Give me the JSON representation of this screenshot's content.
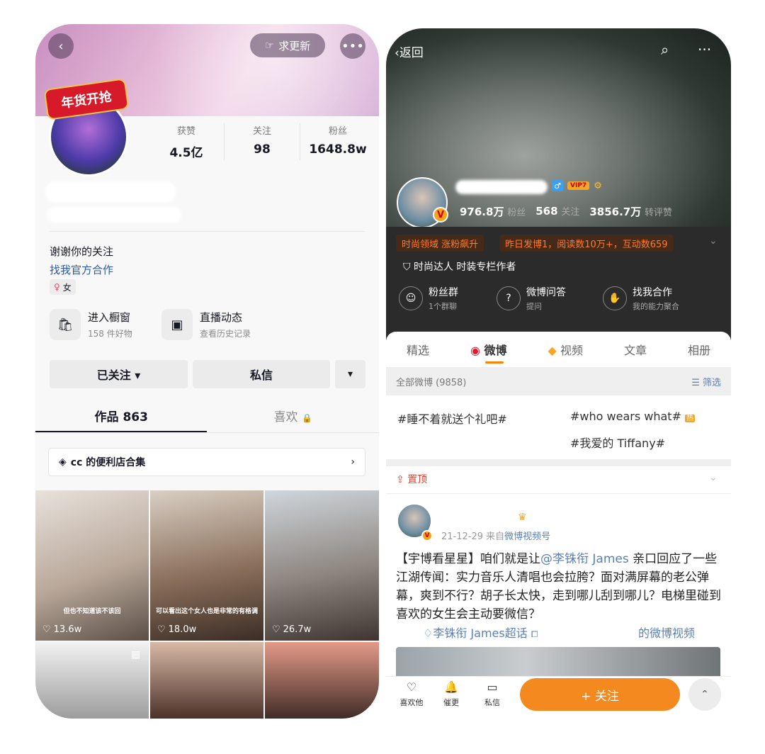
{
  "left": {
    "header": {
      "request_update": "求更新",
      "badge_text": "年货开抢"
    },
    "stats": [
      {
        "label": "获赞",
        "value": "4.5亿"
      },
      {
        "label": "关注",
        "value": "98"
      },
      {
        "label": "粉丝",
        "value": "1648.8w"
      }
    ],
    "bio": {
      "line1": "谢谢你的关注",
      "line2": "找我官方合作",
      "gender": "女"
    },
    "tools": [
      {
        "title": "进入橱窗",
        "sub": "158 件好物"
      },
      {
        "title": "直播动态",
        "sub": "查看历史记录"
      }
    ],
    "actions": {
      "followed": "已关注 ▾",
      "message": "私信",
      "more": "▾"
    },
    "tabs": {
      "works": "作品 863",
      "likes": "喜欢"
    },
    "collection": {
      "label": "cc 的便利店合集"
    },
    "thumbs": [
      {
        "likes": "13.6w",
        "caption": "但也不知道该不该回"
      },
      {
        "likes": "18.0w",
        "caption": "可以看出这个女人也是非常的有格调"
      },
      {
        "likes": "26.7w",
        "caption": ""
      }
    ]
  },
  "right": {
    "header": {
      "back": "返回",
      "vip": "VIP7"
    },
    "stats": {
      "fans_num": "976.8万",
      "fans_label": "粉丝",
      "follow_num": "568",
      "follow_label": "关注",
      "reposts_num": "3856.7万",
      "reposts_label": "转评赞"
    },
    "tags": [
      "时尚领域 涨粉飙升",
      "昨日发博1，阅读数10万+，互动数659"
    ],
    "cert": "时尚达人 时装专栏作者",
    "tools": [
      {
        "title": "粉丝群",
        "sub": "1个群聊"
      },
      {
        "title": "微博问答",
        "sub": "提问"
      },
      {
        "title": "找我合作",
        "sub": "我的能力聚合"
      }
    ],
    "tabs": [
      "精选",
      "微博",
      "视频",
      "文章",
      "相册"
    ],
    "all_label": "全部微博 (9858)",
    "filter_label": "筛选",
    "topics": [
      "#睡不着就送个礼吧#",
      "#who wears what#",
      "#我爱的 Tiffany#"
    ],
    "hot_label": "热",
    "pin_label": "置顶",
    "post": {
      "meta_time": "21-12-29",
      "meta_from": "来自",
      "meta_source": "微博视频号",
      "text_a": "【宇博看星星】咱们就是让",
      "mention": "@李铢衔 James",
      "text_b": "亲口回应了一些江湖传闻：实力音乐人清唱也会拉胯？面对满屏幕的老公弹幕，爽到不行？胡子长太快，走到哪儿刮到哪儿？电梯里碰到喜欢的女生会主动要微信？",
      "link1": "李铢衔 James超话",
      "link2": "的微博视频"
    },
    "bottom": [
      {
        "label": "喜欢他"
      },
      {
        "label": "催更"
      },
      {
        "label": "私信"
      }
    ],
    "follow_btn": "+ 关注"
  }
}
